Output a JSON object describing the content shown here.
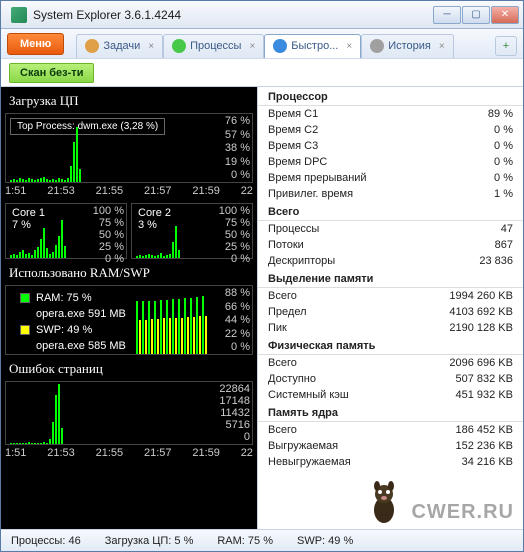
{
  "window": {
    "title": "System Explorer 3.6.1.4244"
  },
  "toolbar": {
    "menu": "Меню"
  },
  "tabs": {
    "items": [
      {
        "label": "Задачи",
        "icon": "#e0a048"
      },
      {
        "label": "Процессы",
        "icon": "#48c848"
      },
      {
        "label": "Быстро...",
        "icon": "#3a8ae0",
        "active": true
      },
      {
        "label": "История",
        "icon": "#a0a0a0"
      }
    ]
  },
  "subbar": {
    "scan": "Скан без-ти"
  },
  "charts": {
    "cpu": {
      "title": "Загрузка ЦП",
      "top_process": "Top Process: dwm.exe (3,28 %)",
      "y_ticks": [
        "76 %",
        "57 %",
        "38 %",
        "19 %",
        "0 %"
      ],
      "x_ticks": [
        "1:51",
        "21:53",
        "21:55",
        "21:57",
        "21:59",
        "22"
      ]
    },
    "cores": {
      "core1": {
        "label": "Core 1",
        "val": "7 %",
        "y": [
          "100 %",
          "75 %",
          "50 %",
          "25 %",
          "0 %"
        ]
      },
      "core2": {
        "label": "Core 2",
        "val": "3 %",
        "y": [
          "100 %",
          "75 %",
          "50 %",
          "25 %",
          "0 %"
        ]
      }
    },
    "ram": {
      "title": "Использовано RAM/SWP",
      "ram_label": "RAM: 75 %",
      "ram_proc": "opera.exe 591 MB",
      "swp_label": "SWP: 49 %",
      "swp_proc": "opera.exe 585 MB",
      "y_ticks": [
        "88 %",
        "66 %",
        "44 %",
        "22 %",
        "0 %"
      ]
    },
    "pf": {
      "title": "Ошибок страниц",
      "y_ticks": [
        "22864",
        "17148",
        "11432",
        "5716",
        "0"
      ],
      "x_ticks": [
        "1:51",
        "21:53",
        "21:55",
        "21:57",
        "21:59",
        "22"
      ]
    }
  },
  "info": {
    "sections": [
      {
        "header": "Процессор",
        "rows": [
          {
            "l": "Время C1",
            "v": "89 %"
          },
          {
            "l": "Время C2",
            "v": "0 %"
          },
          {
            "l": "Время C3",
            "v": "0 %"
          },
          {
            "l": "Время DPC",
            "v": "0 %"
          },
          {
            "l": "Время прерываний",
            "v": "0 %"
          },
          {
            "l": "Привилег. время",
            "v": "1 %"
          }
        ]
      },
      {
        "header": "Всего",
        "rows": [
          {
            "l": "Процессы",
            "v": "47"
          },
          {
            "l": "Потоки",
            "v": "867"
          },
          {
            "l": "Дескрипторы",
            "v": "23 836"
          }
        ]
      },
      {
        "header": "Выделение памяти",
        "rows": [
          {
            "l": "Всего",
            "v": "1994 260 KB"
          },
          {
            "l": "Предел",
            "v": "4103 692 KB"
          },
          {
            "l": "Пик",
            "v": "2190 128 KB"
          }
        ]
      },
      {
        "header": "Физическая память",
        "rows": [
          {
            "l": "Всего",
            "v": "2096 696 KB"
          },
          {
            "l": "Доступно",
            "v": "507 832 KB"
          },
          {
            "l": "Системный кэш",
            "v": "451 932 KB"
          }
        ]
      },
      {
        "header": "Память ядра",
        "rows": [
          {
            "l": "Всего",
            "v": "186 452 KB"
          },
          {
            "l": "Выгружаемая",
            "v": "152 236 KB"
          },
          {
            "l": "Невыгружаемая",
            "v": "34 216 KB"
          }
        ]
      }
    ]
  },
  "status": {
    "procs": "Процессы: 46",
    "cpu": "Загрузка ЦП: 5 %",
    "ram": "RAM: 75 %",
    "swp": "SWP: 49 %"
  },
  "watermark": "CWER.RU",
  "chart_data": {
    "cpu": {
      "type": "line",
      "ylim": [
        0,
        76
      ],
      "x": [
        "1:51",
        "21:53",
        "21:55",
        "21:57",
        "21:59",
        "22"
      ],
      "values_approx": [
        2,
        3,
        2,
        4,
        3,
        2,
        5,
        3,
        2,
        3,
        4,
        6,
        3,
        2,
        3,
        2,
        4,
        3,
        2,
        5,
        18,
        45,
        62,
        15
      ]
    },
    "core1": {
      "type": "line",
      "ylim": [
        0,
        100
      ],
      "values_approx": [
        5,
        8,
        6,
        12,
        15,
        8,
        10,
        6,
        14,
        20,
        35,
        55,
        18,
        8,
        12,
        25,
        40,
        70,
        22
      ]
    },
    "core2": {
      "type": "line",
      "ylim": [
        0,
        100
      ],
      "values_approx": [
        3,
        5,
        4,
        6,
        8,
        5,
        4,
        6,
        10,
        4,
        6,
        8,
        30,
        60,
        14
      ]
    },
    "ram": {
      "type": "line",
      "ylim": [
        0,
        88
      ],
      "series": [
        {
          "name": "RAM",
          "values_approx": [
            68,
            68,
            69,
            69,
            70,
            70,
            71,
            71,
            72,
            73,
            74,
            75
          ]
        },
        {
          "name": "SWP",
          "values_approx": [
            44,
            44,
            45,
            45,
            46,
            46,
            47,
            47,
            48,
            48,
            49,
            49
          ]
        }
      ]
    },
    "page_faults": {
      "type": "line",
      "ylim": [
        0,
        22864
      ],
      "x": [
        "1:51",
        "21:53",
        "21:55",
        "21:57",
        "21:59",
        "22"
      ],
      "values_approx": [
        300,
        400,
        350,
        500,
        450,
        300,
        600,
        400,
        500,
        450,
        350,
        600,
        400,
        2000,
        8000,
        18000,
        22000,
        6000
      ]
    }
  }
}
